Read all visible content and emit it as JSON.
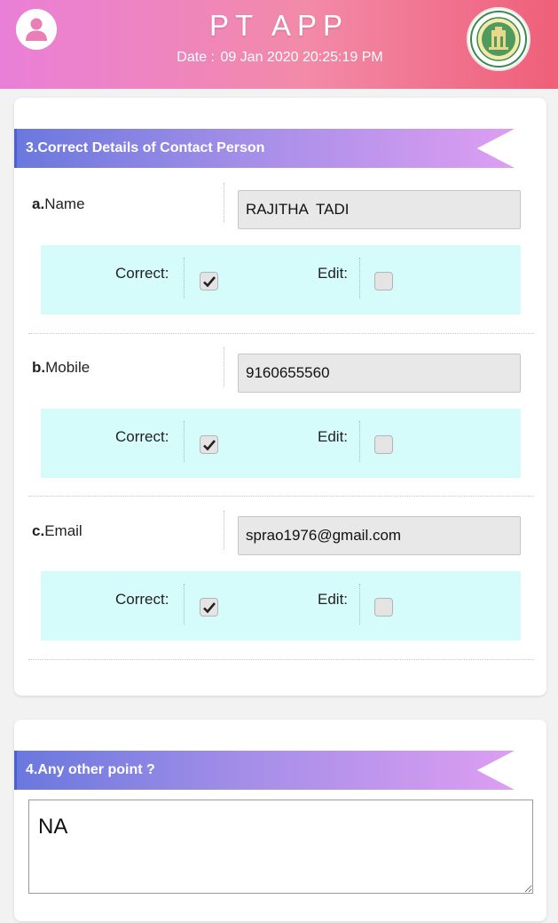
{
  "header": {
    "title": "PT APP",
    "date_label": "Date :",
    "date_value": "09 Jan 2020 20:25:19 PM",
    "avatar_icon": "user-icon",
    "emblem_icon": "government-emblem"
  },
  "section3": {
    "title": "3.Correct Details of Contact Person",
    "fields": [
      {
        "prefix": "a.",
        "label": "Name",
        "value": "RAJITHA  TADI",
        "correct_label": "Correct:",
        "edit_label": "Edit:",
        "correct_checked": true,
        "edit_checked": false
      },
      {
        "prefix": "b.",
        "label": "Mobile",
        "value": "9160655560",
        "correct_label": "Correct:",
        "edit_label": "Edit:",
        "correct_checked": true,
        "edit_checked": false
      },
      {
        "prefix": "c.",
        "label": "Email",
        "value": "sprao1976@gmail.com",
        "correct_label": "Correct:",
        "edit_label": "Edit:",
        "correct_checked": true,
        "edit_checked": false
      }
    ]
  },
  "section4": {
    "title": "4.Any other point ?",
    "value": "NA"
  },
  "colors": {
    "header_gradient": [
      "#ea7fd8",
      "#ef5f78"
    ],
    "banner_gradient": [
      "#6a78dd",
      "#dd9ef2"
    ],
    "check_panel_bg": "#d5fbfb"
  }
}
